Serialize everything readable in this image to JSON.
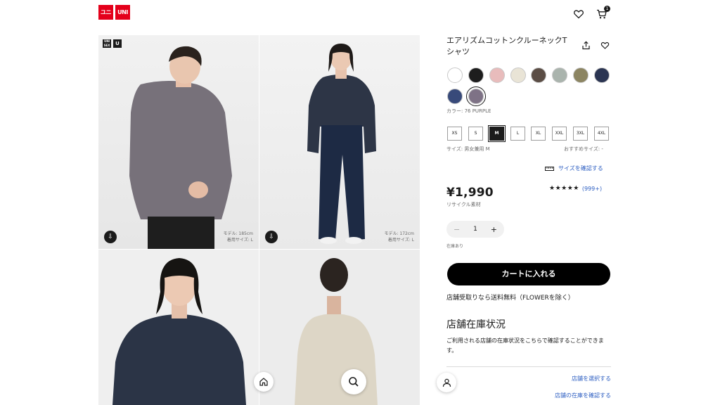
{
  "header": {
    "logo": {
      "top_left": "ユニ",
      "top_right": "UNI",
      "bottom_left": "クロ",
      "bottom_right": "QLO",
      "color": "#e4001b"
    },
    "icons": [
      "heart-icon",
      "cart-icon"
    ],
    "cart_count": "1"
  },
  "gallery": {
    "badges": [
      "UNI SEX",
      "U"
    ],
    "photos": [
      {
        "model_height": "モデル: 185cm",
        "worn_size": "着用サイズ: L",
        "garment_color": "#77717a"
      },
      {
        "model_height": "モデル: 172cm",
        "worn_size": "着用サイズ: L",
        "garment_color": "#2d3546"
      },
      {
        "garment_color": "#2b3446"
      },
      {
        "garment_color": "#ddd6c6"
      }
    ],
    "float_buttons": [
      "home-icon",
      "search-icon"
    ]
  },
  "product": {
    "title": "エアリズムコットンクルーネックTシャツ",
    "color_label": "カラー: 76 PURPLE",
    "swatches": [
      "#ffffff",
      "#1d1d1d",
      "#e8bcbc",
      "#e9e4d6",
      "#5b4d45",
      "#aab4ad",
      "#8c8562",
      "#2b3552",
      "#384a7a",
      "#7e7286"
    ],
    "selected_swatch_index": 9,
    "sizes": [
      "XS",
      "S",
      "M",
      "L",
      "XL",
      "XXL",
      "3XL",
      "4XL"
    ],
    "selected_size_index": 2,
    "size_label": "サイズ: 男女兼用 M",
    "recommend_label": "おすすめサイズ: -",
    "size_check_link": "サイズを確認する",
    "price": "¥1,990",
    "recycle_label": "リサイクル素材",
    "rating_stars": "★★★★★",
    "rating_count": "(999+)",
    "quantity": "1",
    "stock_label": "在庫あり",
    "add_to_cart": "カートに入れる",
    "shipping_note": "店舗受取りなら送料無料（FLOWERを除く）",
    "store_heading": "店舗在庫状況",
    "store_body": "ご利用される店舗の在庫状況をこちらで確認することができます。",
    "select_store_link": "店舗を選択する",
    "check_store_stock_link": "店舗の在庫を確認する"
  }
}
